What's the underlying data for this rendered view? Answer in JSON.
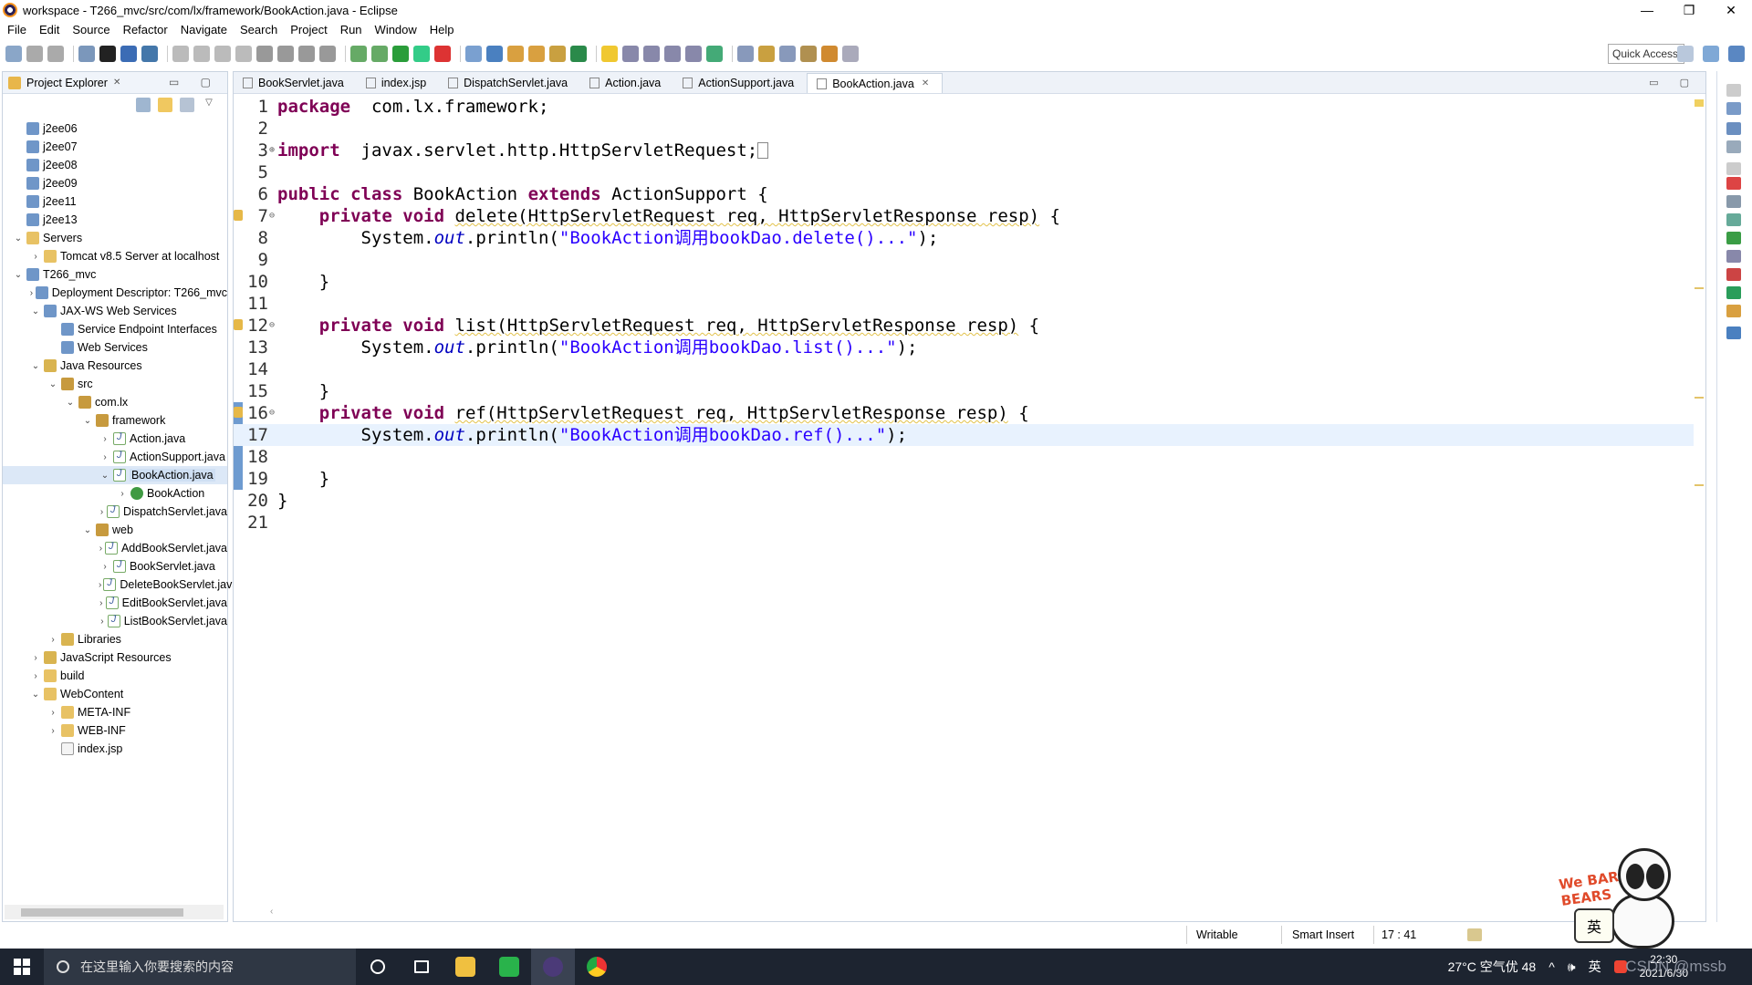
{
  "window": {
    "title": "workspace - T266_mvc/src/com/lx/framework/BookAction.java - Eclipse",
    "controls": [
      "—",
      "❐",
      "✕"
    ]
  },
  "menu": [
    "File",
    "Edit",
    "Source",
    "Refactor",
    "Navigate",
    "Search",
    "Project",
    "Run",
    "Window",
    "Help"
  ],
  "toolbar": {
    "quick_access": "Quick Access"
  },
  "explorer": {
    "title": "Project Explorer",
    "close": "✕",
    "tree": [
      {
        "depth": 0,
        "tw": "",
        "icon": "proj",
        "label": "j2ee06"
      },
      {
        "depth": 0,
        "tw": "",
        "icon": "proj",
        "label": "j2ee07"
      },
      {
        "depth": 0,
        "tw": "",
        "icon": "proj",
        "label": "j2ee08"
      },
      {
        "depth": 0,
        "tw": "",
        "icon": "proj",
        "label": "j2ee09"
      },
      {
        "depth": 0,
        "tw": "",
        "icon": "proj",
        "label": "j2ee11"
      },
      {
        "depth": 0,
        "tw": "",
        "icon": "proj",
        "label": "j2ee13"
      },
      {
        "depth": 0,
        "tw": "⌄",
        "icon": "folder",
        "label": "Servers"
      },
      {
        "depth": 1,
        "tw": "›",
        "icon": "folder",
        "label": "Tomcat v8.5 Server at localhost"
      },
      {
        "depth": 0,
        "tw": "⌄",
        "icon": "proj",
        "label": "T266_mvc"
      },
      {
        "depth": 1,
        "tw": "›",
        "icon": "srv",
        "label": "Deployment Descriptor: T266_mvc"
      },
      {
        "depth": 1,
        "tw": "⌄",
        "icon": "srv",
        "label": "JAX-WS Web Services"
      },
      {
        "depth": 2,
        "tw": "",
        "icon": "srv",
        "label": "Service Endpoint Interfaces"
      },
      {
        "depth": 2,
        "tw": "",
        "icon": "srv",
        "label": "Web Services"
      },
      {
        "depth": 1,
        "tw": "⌄",
        "icon": "lib",
        "label": "Java Resources"
      },
      {
        "depth": 2,
        "tw": "⌄",
        "icon": "pkg",
        "label": "src"
      },
      {
        "depth": 3,
        "tw": "⌄",
        "icon": "pkg",
        "label": "com.lx"
      },
      {
        "depth": 4,
        "tw": "⌄",
        "icon": "pkg",
        "label": "framework"
      },
      {
        "depth": 5,
        "tw": "›",
        "icon": "java",
        "label": "Action.java"
      },
      {
        "depth": 5,
        "tw": "›",
        "icon": "java",
        "label": "ActionSupport.java"
      },
      {
        "depth": 5,
        "tw": "⌄",
        "icon": "java",
        "label": "BookAction.java",
        "selected": true
      },
      {
        "depth": 6,
        "tw": "›",
        "icon": "cls",
        "label": "BookAction"
      },
      {
        "depth": 5,
        "tw": "›",
        "icon": "java",
        "label": "DispatchServlet.java"
      },
      {
        "depth": 4,
        "tw": "⌄",
        "icon": "pkg",
        "label": "web"
      },
      {
        "depth": 5,
        "tw": "›",
        "icon": "java",
        "label": "AddBookServlet.java"
      },
      {
        "depth": 5,
        "tw": "›",
        "icon": "java",
        "label": "BookServlet.java"
      },
      {
        "depth": 5,
        "tw": "›",
        "icon": "java",
        "label": "DeleteBookServlet.java"
      },
      {
        "depth": 5,
        "tw": "›",
        "icon": "java",
        "label": "EditBookServlet.java"
      },
      {
        "depth": 5,
        "tw": "›",
        "icon": "java",
        "label": "ListBookServlet.java"
      },
      {
        "depth": 2,
        "tw": "›",
        "icon": "lib",
        "label": "Libraries"
      },
      {
        "depth": 1,
        "tw": "›",
        "icon": "lib",
        "label": "JavaScript Resources"
      },
      {
        "depth": 1,
        "tw": "›",
        "icon": "folder",
        "label": "build"
      },
      {
        "depth": 1,
        "tw": "⌄",
        "icon": "folder",
        "label": "WebContent"
      },
      {
        "depth": 2,
        "tw": "›",
        "icon": "folder",
        "label": "META-INF"
      },
      {
        "depth": 2,
        "tw": "›",
        "icon": "folder",
        "label": "WEB-INF"
      },
      {
        "depth": 2,
        "tw": "",
        "icon": "file",
        "label": "index.jsp"
      }
    ]
  },
  "editor": {
    "tabs": [
      {
        "label": "BookServlet.java",
        "active": false
      },
      {
        "label": "index.jsp",
        "active": false
      },
      {
        "label": "DispatchServlet.java",
        "active": false
      },
      {
        "label": "Action.java",
        "active": false
      },
      {
        "label": "ActionSupport.java",
        "active": false
      },
      {
        "label": "BookAction.java",
        "active": true
      }
    ],
    "lines": [
      {
        "n": "1",
        "tokens": [
          [
            "kw",
            "package"
          ],
          [
            "",
            "  com.lx.framework;"
          ]
        ]
      },
      {
        "n": "2",
        "tokens": []
      },
      {
        "n": "3",
        "fold": "⊕",
        "tokens": [
          [
            "kw",
            "import"
          ],
          [
            "",
            "  javax.servlet.http.HttpServletRequest;"
          ],
          [
            "box",
            ""
          ]
        ]
      },
      {
        "n": "5",
        "tokens": []
      },
      {
        "n": "6",
        "tokens": [
          [
            "kw",
            "public"
          ],
          [
            "",
            " "
          ],
          [
            "kw",
            "class"
          ],
          [
            "",
            " BookAction "
          ],
          [
            "kw",
            "extends"
          ],
          [
            "",
            " ActionSupport {"
          ]
        ]
      },
      {
        "n": "7",
        "fold": "⊖",
        "marker": true,
        "tokens": [
          [
            "",
            "    "
          ],
          [
            "kw",
            "private"
          ],
          [
            "",
            " "
          ],
          [
            "kw",
            "void"
          ],
          [
            "",
            " "
          ],
          [
            "warn",
            "delete(HttpServletRequest req, HttpServletResponse resp)"
          ],
          [
            "",
            " {"
          ]
        ]
      },
      {
        "n": "8",
        "tokens": [
          [
            "",
            "        System."
          ],
          [
            "fld",
            "out"
          ],
          [
            "",
            ".println("
          ],
          [
            "str",
            "\"BookAction调用bookDao.delete()...\""
          ],
          [
            "",
            ");"
          ]
        ]
      },
      {
        "n": "9",
        "tokens": []
      },
      {
        "n": "10",
        "tokens": [
          [
            "",
            "    }"
          ]
        ]
      },
      {
        "n": "11",
        "tokens": []
      },
      {
        "n": "12",
        "fold": "⊖",
        "marker": true,
        "tokens": [
          [
            "",
            "    "
          ],
          [
            "kw",
            "private"
          ],
          [
            "",
            " "
          ],
          [
            "kw",
            "void"
          ],
          [
            "",
            " "
          ],
          [
            "warn",
            "list(HttpServletRequest req, HttpServletResponse resp)"
          ],
          [
            "",
            " {"
          ]
        ]
      },
      {
        "n": "13",
        "tokens": [
          [
            "",
            "        System."
          ],
          [
            "fld",
            "out"
          ],
          [
            "",
            ".println("
          ],
          [
            "str",
            "\"BookAction调用bookDao.list()...\""
          ],
          [
            "",
            ");"
          ]
        ]
      },
      {
        "n": "14",
        "tokens": []
      },
      {
        "n": "15",
        "tokens": [
          [
            "",
            "    }"
          ]
        ]
      },
      {
        "n": "16",
        "fold": "⊖",
        "marker": true,
        "tokens": [
          [
            "",
            "    "
          ],
          [
            "kw",
            "private"
          ],
          [
            "",
            " "
          ],
          [
            "kw",
            "void"
          ],
          [
            "",
            " "
          ],
          [
            "warn",
            "ref(HttpServletRequest req, HttpServletResponse resp)"
          ],
          [
            "",
            " {"
          ]
        ]
      },
      {
        "n": "17",
        "current": true,
        "tokens": [
          [
            "",
            "        System."
          ],
          [
            "fld",
            "out"
          ],
          [
            "",
            ".println("
          ],
          [
            "str",
            "\"BookAction调用bookDao.ref()...\""
          ],
          [
            "",
            ");"
          ]
        ]
      },
      {
        "n": "18",
        "tokens": []
      },
      {
        "n": "19",
        "tokens": [
          [
            "",
            "    }"
          ]
        ]
      },
      {
        "n": "20",
        "tokens": [
          [
            "",
            "}"
          ]
        ]
      },
      {
        "n": "21",
        "tokens": []
      }
    ]
  },
  "status": {
    "writable": "Writable",
    "insert_mode": "Smart Insert",
    "position": "17 : 41"
  },
  "mascot": {
    "brand": "We BARE BEARS",
    "ime": "英"
  },
  "taskbar": {
    "search_placeholder": "在这里输入你要搜索的内容",
    "weather": "27°C 空气优 48",
    "volume": "🕪",
    "ime": "英",
    "time": "22:30",
    "date": "2021/6/30",
    "watermark": "CSDN @mssb"
  },
  "colors": {
    "keyword": "#7f0055",
    "string": "#2a00ff",
    "field": "#0000c0",
    "current_line": "#e8f2fe",
    "taskbar": "#1d2430"
  }
}
